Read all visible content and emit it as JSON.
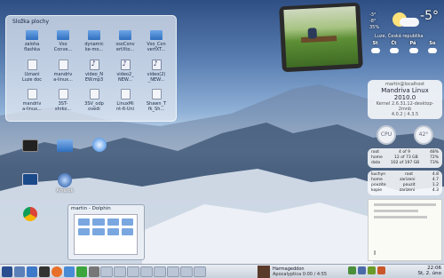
{
  "desktop": {
    "name": "KDE Plasma desktop"
  },
  "folder_view": {
    "title": "Složka plochy",
    "items": [
      {
        "label": "zaloha\nflashka",
        "icon": "folder-icon"
      },
      {
        "label": "Vso\nConve...",
        "icon": "folder-icon"
      },
      {
        "label": "dynamic\nke-mo...",
        "icon": "folder-icon"
      },
      {
        "label": "vsoConv\nertXto...",
        "icon": "folder-icon"
      },
      {
        "label": "Vso_Con\nvertXT...",
        "icon": "folder-icon"
      },
      {
        "label": "Uznani\nLuze doc",
        "icon": "document-icon"
      },
      {
        "label": "mandriv\na-linux...",
        "icon": "document-icon"
      },
      {
        "label": "video_N\nEW.mp3",
        "icon": "audio-file-icon"
      },
      {
        "label": "video2_\nNEW...",
        "icon": "audio-file-icon"
      },
      {
        "label": "video(2)\n_NEW...",
        "icon": "audio-file-icon"
      },
      {
        "label": "mandriv\na-linux...",
        "icon": "document-icon"
      },
      {
        "label": "3ST-\nshrko...",
        "icon": "document-icon"
      },
      {
        "label": "3SV_odp\novedi",
        "icon": "document-icon"
      },
      {
        "label": "LinuxMi\nnt-6-Uni",
        "icon": "document-icon"
      },
      {
        "label": "Shawn_T\nfk_Sh...",
        "icon": "document-icon"
      }
    ]
  },
  "desktop_icons": [
    {
      "label": "",
      "icon": "terminal-icon"
    },
    {
      "label": "",
      "icon": "archive-icon"
    },
    {
      "label": "",
      "icon": "safari-icon"
    },
    {
      "label": "",
      "icon": "system-monitor-icon"
    },
    {
      "label": "Amarok",
      "icon": "amarok-icon"
    },
    {
      "label": "",
      "icon": "chrome-icon"
    }
  ],
  "weather": {
    "temperature": "-5°",
    "location": "Luze, Česká republika",
    "details": [
      "-3°",
      "-8°",
      "35%"
    ],
    "days": [
      "St",
      "Čt",
      "Pá",
      "So"
    ]
  },
  "system_monitor": {
    "host": "martin@localhost",
    "os": "Mandriva Linux 2010.0",
    "kernel": "Kernel 2.6.31.12-desktop-2mnb",
    "uptime": "4.0.2 | 4.3.5",
    "cpu_label": "CPU",
    "cpu_value": "42°",
    "memory": [
      {
        "name": "root",
        "used": "4 of 9",
        "pct": "48%"
      },
      {
        "name": "home",
        "used": "12 of 73 GB",
        "pct": "72%"
      },
      {
        "name": "data",
        "used": "102 of 197 GB",
        "pct": "73%"
      }
    ],
    "disk_rows": [
      {
        "name": "kuchyn",
        "a": "root",
        "b": "4.8"
      },
      {
        "name": "home",
        "a": "zarizeni",
        "b": "4.7"
      },
      {
        "name": "pouzite",
        "a": "pouzit",
        "b": "1.2"
      },
      {
        "name": "kopie",
        "a": "zarizeni",
        "b": "4.3"
      }
    ]
  },
  "dolphin_window": {
    "title": "martin - Dolphin"
  },
  "taskbar": {
    "media_title": "Harmageddon",
    "media_artist": "Apocalyptica",
    "media_time": "0:00 / 4:55",
    "clock_time": "22:06",
    "clock_date": "St, 2. úno"
  },
  "colors": {
    "taskbar": "#d4dbe5",
    "accent": "#2f6fbf"
  }
}
